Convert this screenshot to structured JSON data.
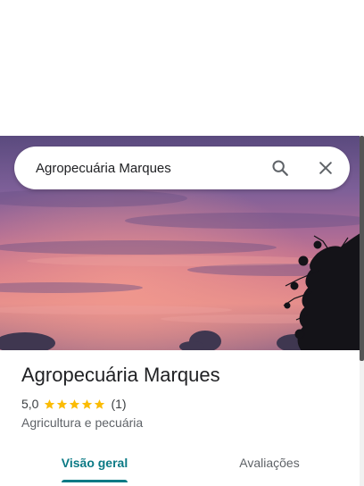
{
  "search": {
    "value": "Agropecuária Marques",
    "search_icon": "search-icon",
    "close_icon": "close-icon"
  },
  "hero": {
    "image": "sunset-sky-photo"
  },
  "place": {
    "name": "Agropecuária Marques",
    "rating": "5,0",
    "stars": 5,
    "review_count": "(1)",
    "category": "Agricultura e pecuária"
  },
  "tabs": [
    {
      "label": "Visão geral",
      "selected": true
    },
    {
      "label": "Avaliações",
      "selected": false
    }
  ],
  "colors": {
    "accent": "#0b7a85",
    "star": "#fbbc04"
  }
}
